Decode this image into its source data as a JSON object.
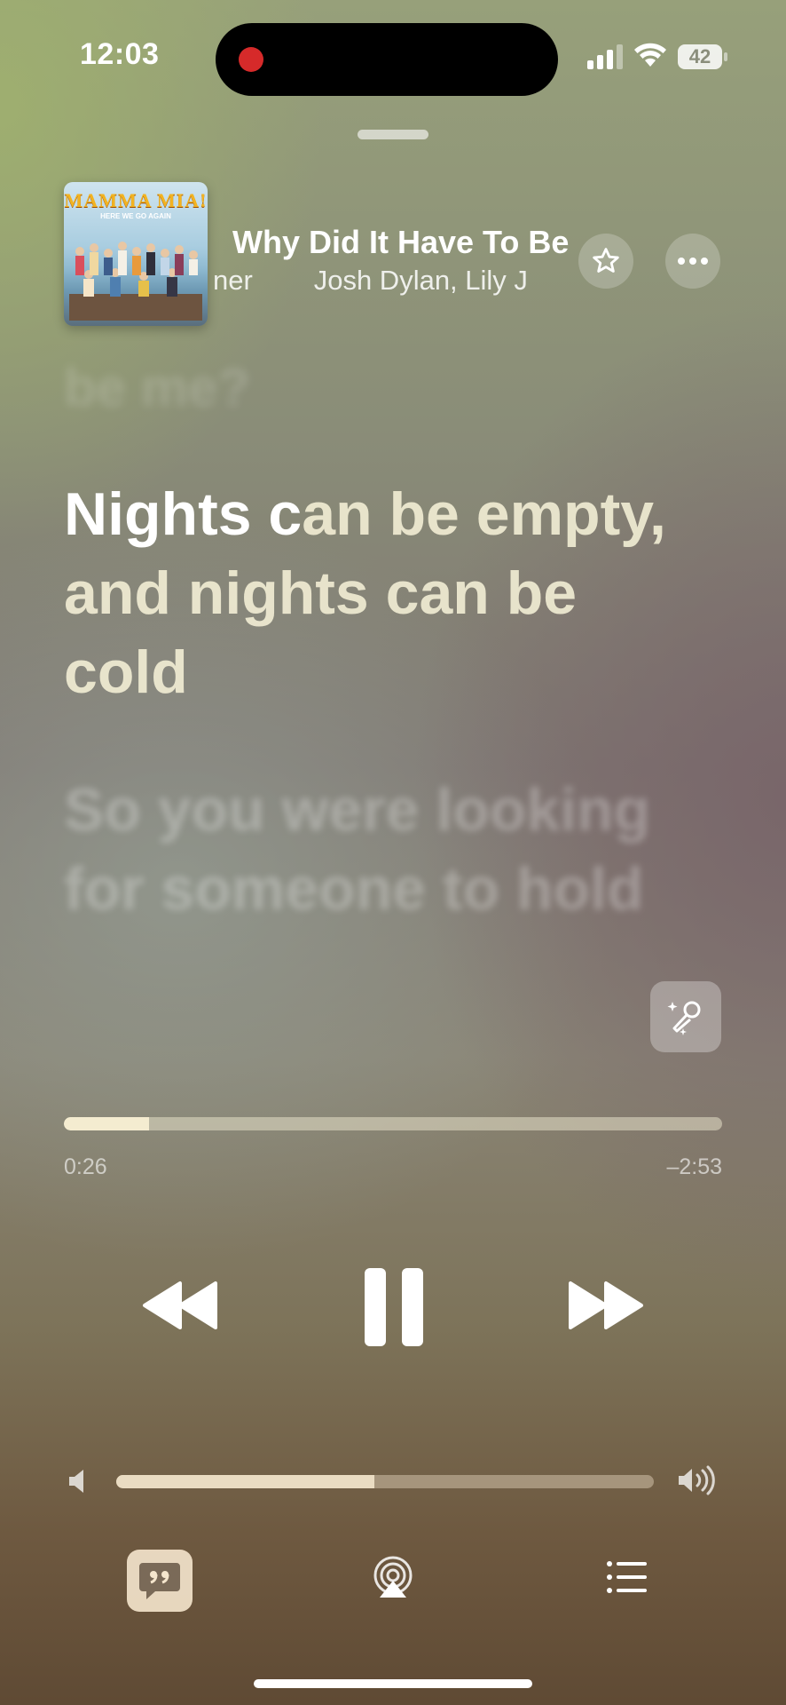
{
  "status": {
    "time": "12:03",
    "battery": "42"
  },
  "now_playing": {
    "title": "Why Did It Have To Be",
    "artist_scroll": "ner        Josh Dylan, Lily J",
    "album_logo": "MAMMA MIA!",
    "album_subtitle": "HERE WE GO AGAIN"
  },
  "lyrics": {
    "previous": "be me?",
    "current_highlight": "Nights c",
    "current_rest": "an be empty, and nights can be cold",
    "next": "So you were looking for someone to hold"
  },
  "progress": {
    "elapsed": "0:26",
    "remaining": "–2:53",
    "fraction": 0.13
  },
  "volume": {
    "fraction": 0.48
  },
  "colors": {
    "accent": "#f4ecd0",
    "record": "#d62a2a"
  }
}
